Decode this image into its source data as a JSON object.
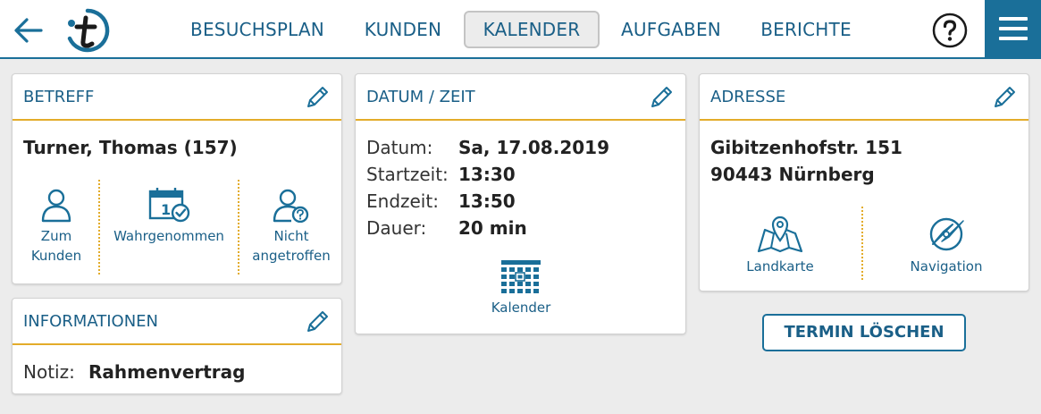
{
  "header": {
    "nav": [
      {
        "label": "BESUCHSPLAN",
        "active": false
      },
      {
        "label": "KUNDEN",
        "active": false
      },
      {
        "label": "KALENDER",
        "active": true
      },
      {
        "label": "AUFGABEN",
        "active": false
      },
      {
        "label": "BERICHTE",
        "active": false
      }
    ],
    "back_icon": "arrow-left-icon",
    "logo_icon": "t-logo-icon",
    "help_icon": "question-circle-icon",
    "menu_icon": "hamburger-icon"
  },
  "colors": {
    "brand": "#1a6f99",
    "accent": "#e3ac2a",
    "text_link": "#1a5f87"
  },
  "betreff": {
    "title": "BETREFF",
    "customer": "Turner, Thomas (157)",
    "actions": [
      {
        "label": "Zum Kunden",
        "icon": "person-icon"
      },
      {
        "label": "Wahrgenommen",
        "icon": "calendar-check-icon"
      },
      {
        "label": "Nicht angetroffen",
        "icon": "person-question-icon"
      }
    ]
  },
  "informationen": {
    "title": "INFORMATIONEN",
    "note_label": "Notiz:",
    "note_value": "Rahmenvertrag"
  },
  "datum_zeit": {
    "title": "DATUM / ZEIT",
    "rows": [
      {
        "label": "Datum:",
        "value": "Sa, 17.08.2019"
      },
      {
        "label": "Startzeit:",
        "value": "13:30"
      },
      {
        "label": "Endzeit:",
        "value": "13:50"
      },
      {
        "label": "Dauer:",
        "value": "20 min"
      }
    ],
    "calendar_label": "Kalender",
    "calendar_icon": "calendar-grid-icon"
  },
  "adresse": {
    "title": "ADRESSE",
    "street": "Gibitzenhofstr. 151",
    "city": "90443 Nürnberg",
    "actions": [
      {
        "label": "Landkarte",
        "icon": "map-icon"
      },
      {
        "label": "Navigation",
        "icon": "compass-icon"
      }
    ]
  },
  "delete_button": "TERMIN LÖSCHEN"
}
